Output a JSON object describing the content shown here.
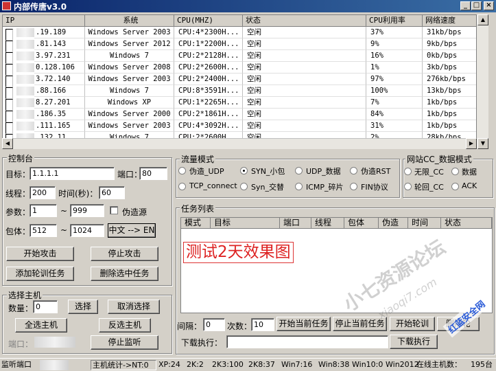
{
  "window": {
    "title": "内部传唐v3.0",
    "controls": [
      "_",
      "□",
      "×"
    ]
  },
  "hosts": {
    "columns": [
      "IP",
      "系统",
      "CPU(MHZ)",
      "状态",
      "CPU利用率",
      "网络速度"
    ],
    "rows": [
      {
        "ip": ".19.189",
        "os": "Windows Server 2003",
        "cpu": "CPU:4*2300H...",
        "status": "空闲",
        "usage": "37%",
        "speed": "31kb/bps"
      },
      {
        "ip": ".81.143",
        "os": "Windows Server 2012",
        "cpu": "CPU:1*2200H...",
        "status": "空闲",
        "usage": "9%",
        "speed": "9kb/bps"
      },
      {
        "ip": "3.97.231",
        "os": "Windows 7",
        "cpu": "CPU:2*2128H...",
        "status": "空闲",
        "usage": "16%",
        "speed": "0kb/bps"
      },
      {
        "ip": "0.128.106",
        "os": "Windows Server 2008",
        "cpu": "CPU:2*2600H...",
        "status": "空闲",
        "usage": "1%",
        "speed": "3kb/bps"
      },
      {
        "ip": "3.72.140",
        "os": "Windows Server 2003",
        "cpu": "CPU:2*2400H...",
        "status": "空闲",
        "usage": "97%",
        "speed": "276kb/bps"
      },
      {
        "ip": ".88.166",
        "os": "Windows 7",
        "cpu": "CPU:8*3591H...",
        "status": "空闲",
        "usage": "100%",
        "speed": "13kb/bps"
      },
      {
        "ip": "8.27.201",
        "os": "Windows XP",
        "cpu": "CPU:1*2265H...",
        "status": "空闲",
        "usage": "7%",
        "speed": "1kb/bps"
      },
      {
        "ip": ".186.35",
        "os": "Windows Server 2000",
        "cpu": "CPU:2*1861H...",
        "status": "空闲",
        "usage": "84%",
        "speed": "1kb/bps"
      },
      {
        "ip": ".111.165",
        "os": "Windows Server 2003",
        "cpu": "CPU:4*3092H...",
        "status": "空闲",
        "usage": "31%",
        "speed": "1kb/bps"
      },
      {
        "ip": ".132.11",
        "os": "Windows 7",
        "cpu": "CPU:2*2600H...",
        "status": "空闲",
        "usage": "2%",
        "speed": "28kb/bps"
      }
    ]
  },
  "control": {
    "title": "控制台",
    "target_label": "目标：",
    "target_value": "1.1.1.1",
    "port_label": "端口：",
    "port_value": "80",
    "threads_label": "线程：",
    "threads_value": "200",
    "time_label": "时间(秒)：",
    "time_value": "60",
    "params_label": "参数：",
    "param_from": "1",
    "tilde": "~",
    "param_to": "999",
    "spoof_label": "伪造源",
    "packet_label": "包体：",
    "packet_from": "512",
    "packet_to": "1024",
    "lang_button": "中文 --> EN",
    "start_attack": "开始攻击",
    "stop_attack": "停止攻击",
    "add_rotation": "添加轮训任务",
    "delete_task": "删除选中任务"
  },
  "traffic": {
    "title": "流量模式",
    "options": [
      "伪造_UDP",
      "SYN_小包",
      "UDP_数据",
      "伪造RST",
      "TCP_connect",
      "Syn_交替",
      "ICMP_碎片",
      "FIN协议"
    ],
    "selected": "SYN_小包"
  },
  "cc": {
    "title": "网站CC_数据模式",
    "options": [
      "无限_CC",
      "数据",
      "轮回_CC",
      "ACK"
    ]
  },
  "select_host": {
    "title": "选择主机",
    "count_label": "数量：",
    "count_value": "0",
    "select": "选择",
    "cancel_select": "取消选择",
    "select_all": "全选主机",
    "invert": "反选主机",
    "port_label": "端口：",
    "stop_listen": "停止监听"
  },
  "tasks": {
    "title": "任务列表",
    "columns": [
      "模式",
      "目标",
      "端口",
      "线程",
      "包体",
      "伪造",
      "时间",
      "状态"
    ],
    "overlay_text": "测试2天效果图",
    "interval_label": "间隔：",
    "interval_value": "0",
    "times_label": "次数：",
    "times_value": "10",
    "start_current": "开始当前任务",
    "stop_current": "停止当前任务",
    "start_rotation": "开始轮训",
    "delete_rotation": "删除轮",
    "download_label": "下载执行：",
    "download_button": "下载执行"
  },
  "status": {
    "listen_port": "监听端口",
    "stats": "主机统计->NT:0",
    "xp": "XP:24",
    "k2": "2K:2",
    "k3": "2K3:100",
    "k8": "2K8:37",
    "win7": "Win7:16",
    "win8": "Win8:38",
    "win10": "Win10:0",
    "win12": "Win2012",
    "online": "在线主机数：",
    "online_count": "195台"
  },
  "watermark": {
    "text1": "小七资源论坛",
    "text2": "xiaoqi7.com",
    "text3": "红蓝安全网"
  }
}
